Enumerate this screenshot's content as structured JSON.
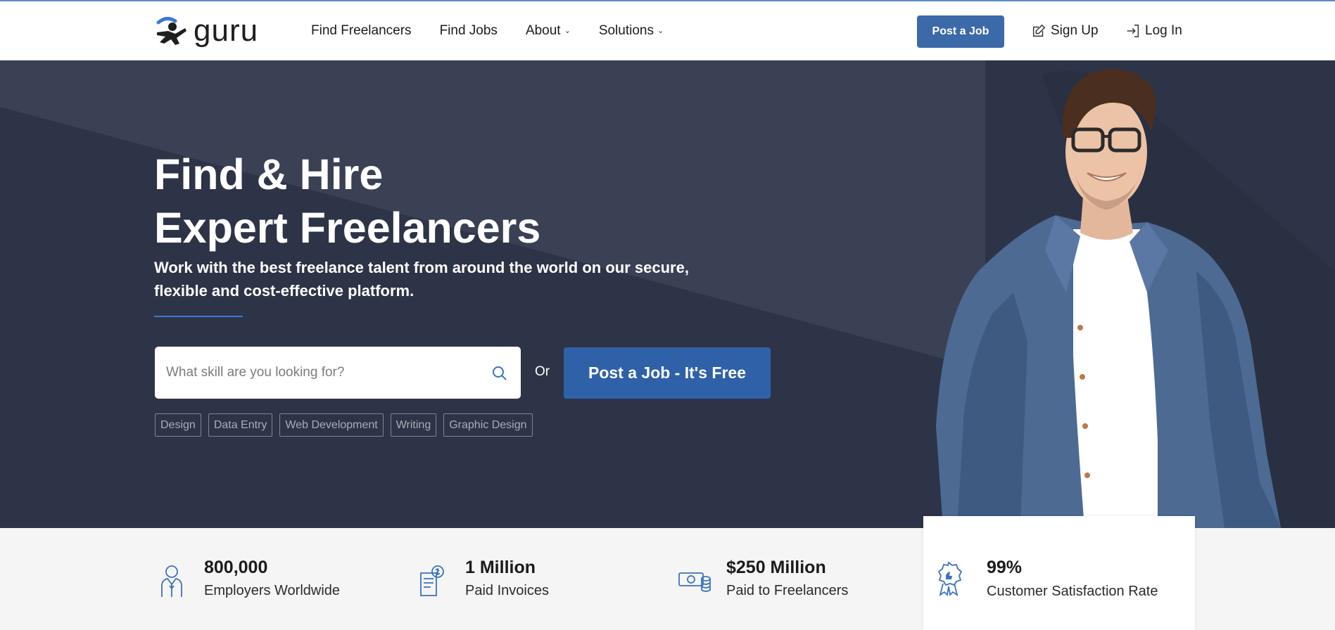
{
  "brand": {
    "logo_text": "guru",
    "accent": "#3c6aa8"
  },
  "nav": {
    "items": [
      {
        "label": "Find Freelancers",
        "dropdown": false
      },
      {
        "label": "Find Jobs",
        "dropdown": false
      },
      {
        "label": "About",
        "dropdown": true
      },
      {
        "label": "Solutions",
        "dropdown": true
      }
    ],
    "post_job": "Post a Job",
    "sign_up": "Sign Up",
    "log_in": "Log In"
  },
  "hero": {
    "title_line1": "Find & Hire",
    "title_line2": "Expert Freelancers",
    "subtitle": "Work with the best freelance talent from around the world on our secure, flexible and cost-effective platform.",
    "search_placeholder": "What skill are you looking for?",
    "or_text": "Or",
    "cta": "Post a Job - It's Free",
    "tags": [
      "Design",
      "Data Entry",
      "Web Development",
      "Writing",
      "Graphic Design"
    ]
  },
  "stats": [
    {
      "value": "800,000",
      "label": "Employers Worldwide",
      "icon": "employer-icon"
    },
    {
      "value": "1 Million",
      "label": "Paid Invoices",
      "icon": "invoice-icon"
    },
    {
      "value": "$250 Million",
      "label": "Paid to Freelancers",
      "icon": "money-icon"
    },
    {
      "value": "99%",
      "label": "Customer Satisfaction Rate",
      "icon": "award-badge-icon"
    }
  ]
}
